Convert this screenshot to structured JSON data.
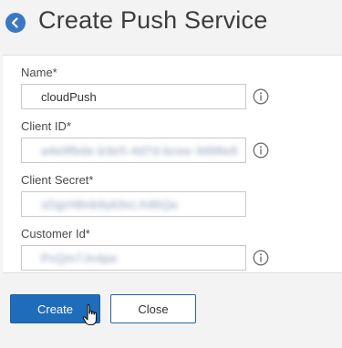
{
  "header": {
    "title": "Create Push Service",
    "back_icon": "arrow-left-circle-icon",
    "accent_color": "#3a78c5"
  },
  "form": {
    "fields": [
      {
        "label": "Name*",
        "value": "cloudPush",
        "has_info": true,
        "masked": false
      },
      {
        "label": "Client ID*",
        "value": "a4e9fbde-b3e5-4d7d-bcee-3d98e6",
        "has_info": true,
        "masked": true
      },
      {
        "label": "Client Secret*",
        "value": "xDgrH8nb9yk9vLXd6Qa",
        "has_info": false,
        "masked": true
      },
      {
        "label": "Customer Id*",
        "value": "PxQm7Jn4pe",
        "has_info": true,
        "masked": true
      }
    ]
  },
  "footer": {
    "create_label": "Create",
    "close_label": "Close",
    "primary_color": "#1f6cbb"
  }
}
